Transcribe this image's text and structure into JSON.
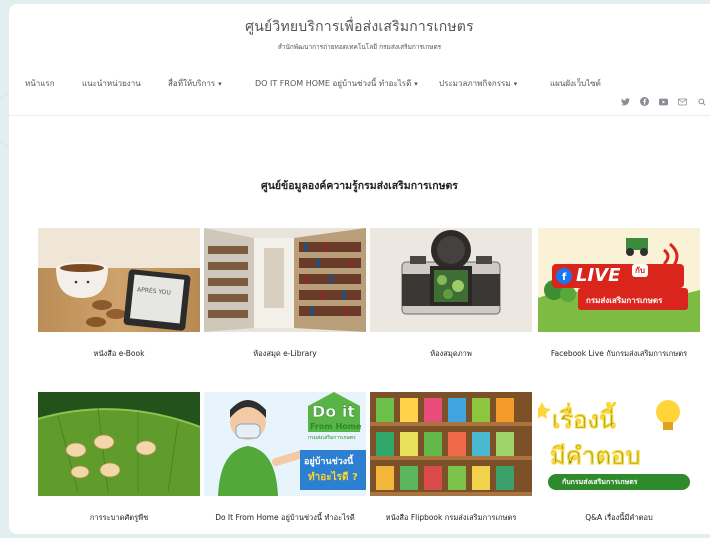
{
  "header": {
    "site_title": "ศูนย์วิทยบริการเพื่อส่งเสริมการเกษตร",
    "subtitle": "สำนักพัฒนาการถ่ายทอดเทคโนโลยี กรมส่งเสริมการเกษตร"
  },
  "nav": {
    "items": [
      {
        "label": "หน้าแรก"
      },
      {
        "label": "แนะนำหน่วยงาน"
      },
      {
        "label": "สื่อที่ให้บริการ"
      },
      {
        "label": "DO IT FROM HOME อยู่บ้านช่วงนี้ ทำอะไรดี"
      },
      {
        "label": "ประมวลภาพกิจกรรม"
      },
      {
        "label": "แผนผังเว็บไซต์"
      }
    ],
    "chevron": "▾"
  },
  "social": [
    "twitter-icon",
    "facebook-icon",
    "youtube-icon",
    "email-icon",
    "search-icon"
  ],
  "main": {
    "section_title": "ศูนย์ข้อมูลองค์ความรู้กรมส่งเสริมการเกษตร",
    "cards": [
      {
        "caption": "หนังสือ e-Book"
      },
      {
        "caption": "ห้องสมุด e-Library"
      },
      {
        "caption": "ห้องสมุดภาพ"
      },
      {
        "caption": "Facebook Live กับกรมส่งเสริมการเกษตร"
      },
      {
        "caption": "การระบาดศัตรูพืช"
      },
      {
        "caption": "Do It From Home อยู่บ้านช่วงนี้ ทำอะไรดี"
      },
      {
        "caption": "หนังสือ Flipbook กรมส่งเสริมการเกษตร"
      },
      {
        "caption": "Q&A เรื่องนี้มีคำตอบ"
      }
    ]
  },
  "thumb_text": {
    "ebook_cover": "APRÈS YOU",
    "live": "LIVE",
    "live_with": "กับ",
    "live_dept": "กรมส่งเสริมการเกษตร",
    "doit_1": "Do it",
    "doit_2": "From Home",
    "doit_3": "กรมส่งเสริมการเกษตร",
    "doit_4": "อยู่บ้านช่วงนี้",
    "doit_5": "ทำอะไรดี ?",
    "qa_1": "เรื่องนี้",
    "qa_2": "มีคำตอบ",
    "qa_3": "กับกรมส่งเสริมการเกษตร"
  }
}
